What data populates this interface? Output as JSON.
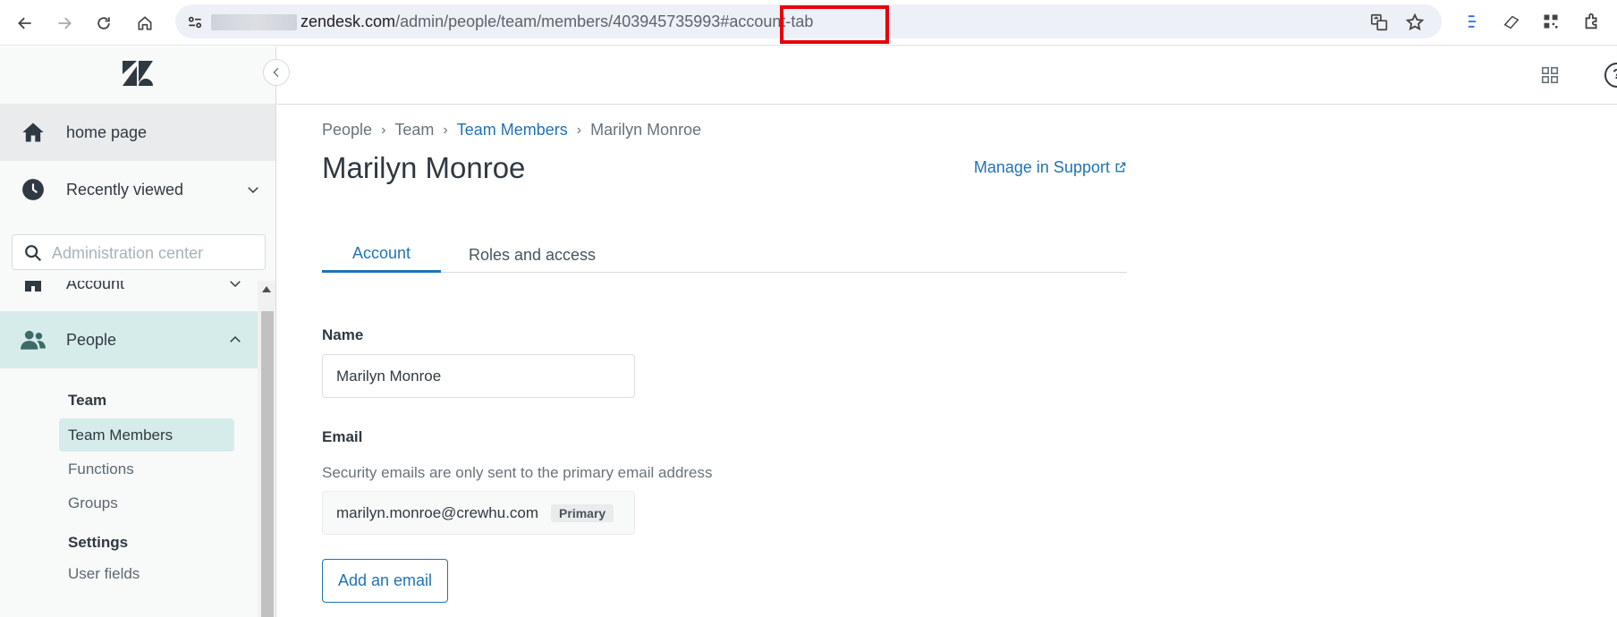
{
  "browser": {
    "url_host": "zendesk.com",
    "url_path": "/admin/people/team/members/",
    "url_id": "403945735993",
    "url_hash": "#account-tab"
  },
  "sidebar": {
    "home_label": "home page",
    "recent_label": "Recently viewed",
    "search_placeholder": "Administration center",
    "account_label": "Account",
    "people_label": "People",
    "team_heading": "Team",
    "team_items": [
      "Team Members",
      "Functions",
      "Groups"
    ],
    "settings_heading": "Settings",
    "settings_items": [
      "User fields"
    ]
  },
  "breadcrumb": [
    "People",
    "Team",
    "Team Members",
    "Marilyn Monroe"
  ],
  "page": {
    "title": "Marilyn Monroe",
    "manage_link": "Manage in Support"
  },
  "tabs": [
    "Account",
    "Roles and access"
  ],
  "form": {
    "name_label": "Name",
    "name_value": "Marilyn Monroe",
    "email_label": "Email",
    "email_hint": "Security emails are only sent to the primary email address",
    "email_value": "marilyn.monroe@crewhu.com",
    "email_badge": "Primary",
    "add_email_label": "Add an email"
  },
  "colors": {
    "accent": "#1f73b7",
    "active_nav": "#d6eceb",
    "highlight_box": "#e8000b"
  }
}
